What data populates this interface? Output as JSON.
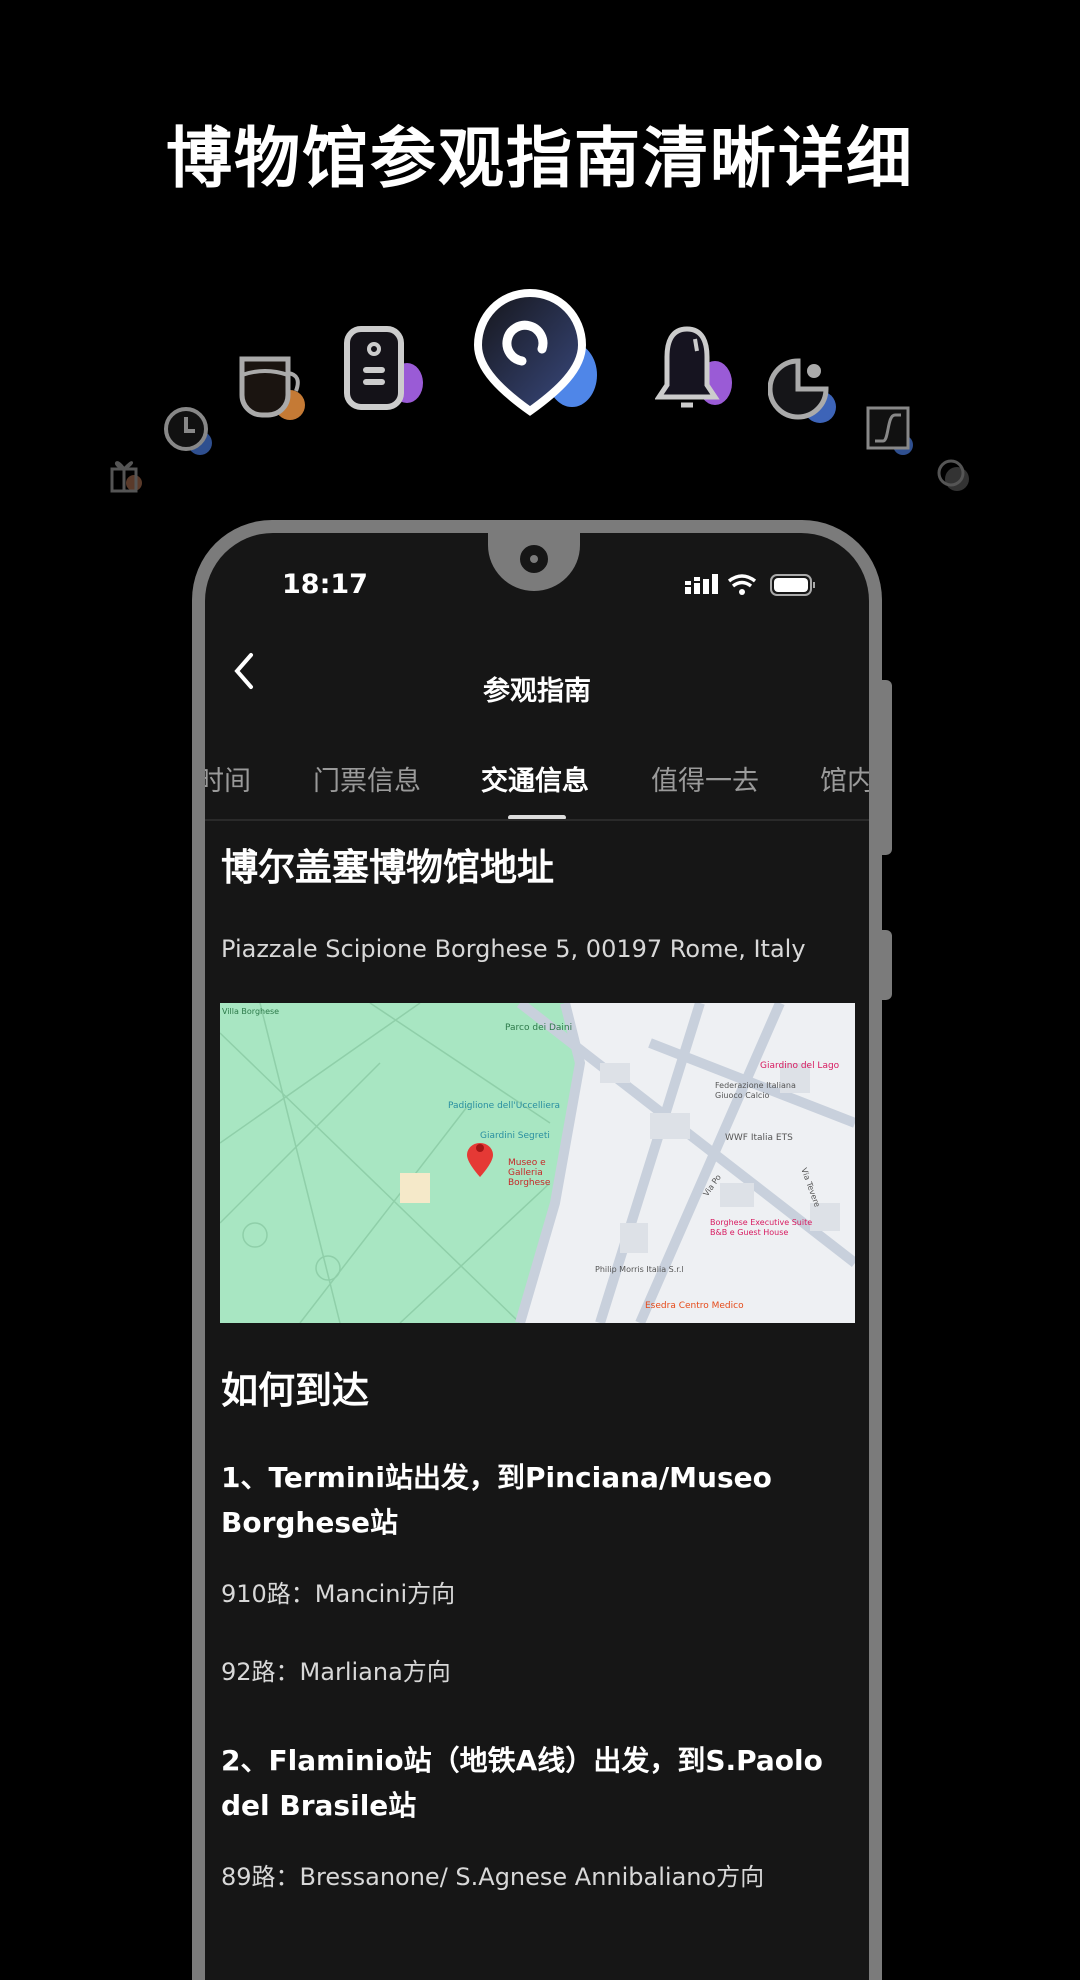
{
  "promo_title": "博物馆参观指南清晰详细",
  "feature_icons": [
    "gift-icon",
    "clock-icon",
    "cup-icon",
    "audio-guide-icon",
    "location-pin-icon",
    "bell-icon",
    "pie-chart-icon",
    "curve-icon",
    "cloud-icon"
  ],
  "colors": {
    "accent_blue": "#4f86e8",
    "accent_purple": "#9a5bd6",
    "accent_orange": "#c57a35",
    "screen_bg": "#161616",
    "frame": "#7b7b7b"
  },
  "status": {
    "time": "18:17"
  },
  "nav": {
    "title": "参观指南"
  },
  "tabs": [
    {
      "label": "时间"
    },
    {
      "label": "门票信息"
    },
    {
      "label": "交通信息",
      "active": true
    },
    {
      "label": "值得一去"
    },
    {
      "label": "馆内"
    }
  ],
  "address": {
    "heading": "博尔盖塞博物馆地址",
    "text": "Piazzale Scipione Borghese 5, 00197 Rome, Italy"
  },
  "map": {
    "labels": [
      "Parco dei Daini",
      "Padiglione dell'Uccelliera",
      "Giardini Segreti",
      "Museo e Galleria Borghese",
      "Giardino del Lago",
      "Federazione Italiana Giuoco Calcio",
      "WWF Italia ETS",
      "Via Po",
      "Via Tevere",
      "Borghese Executive Suite B&B e Guest House",
      "Philip Morris Italia S.r.l",
      "Esedra Centro Medico",
      "Villa Borghese"
    ]
  },
  "directions": {
    "heading": "如何到达",
    "routes": [
      {
        "title": "1、Termini站出发，到Pinciana/Museo Borghese站",
        "lines": [
          "910路：Mancini方向",
          "92路：Marliana方向"
        ]
      },
      {
        "title": "2、Flaminio站（地铁A线）出发，到S.Paolo del Brasile站",
        "lines": [
          "89路：Bressanone/ S.Agnese Annibaliano方向"
        ]
      }
    ]
  }
}
